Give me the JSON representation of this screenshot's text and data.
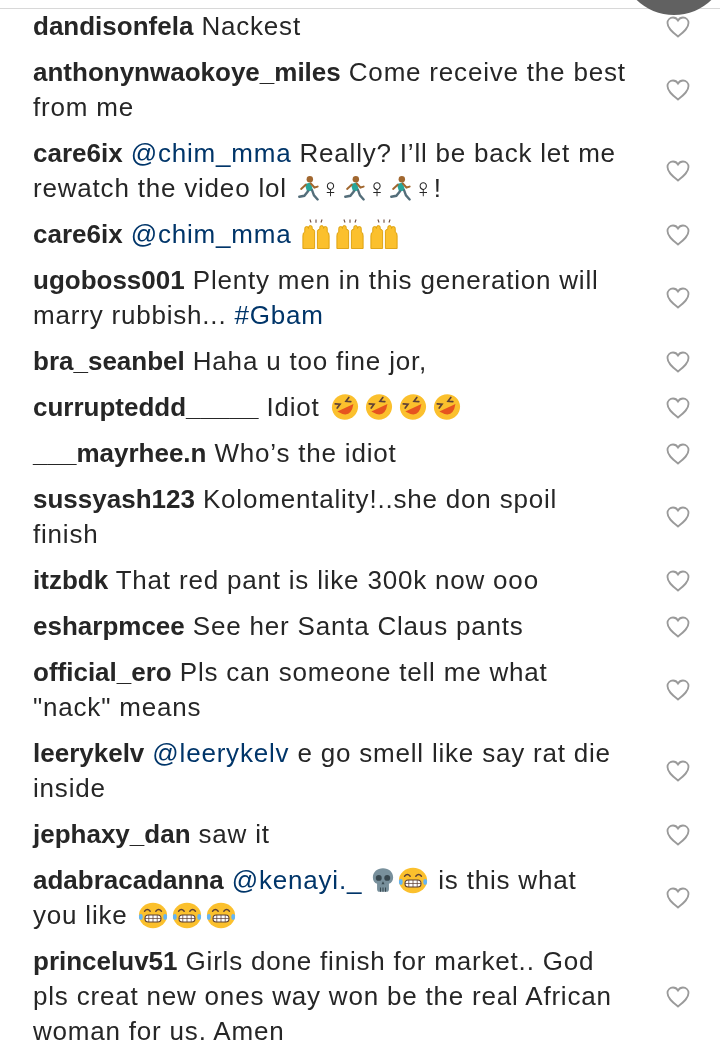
{
  "comments": [
    {
      "username": "dandisonfela",
      "liked": false,
      "parts": [
        {
          "kind": "text",
          "text": "Nackest"
        }
      ]
    },
    {
      "username": "anthonynwaokoye_miles",
      "liked": false,
      "parts": [
        {
          "kind": "text",
          "text": "Come receive the best from me"
        }
      ]
    },
    {
      "username": "care6ix",
      "liked": false,
      "parts": [
        {
          "kind": "mention",
          "text": "@chim_mma"
        },
        {
          "kind": "text",
          "text": "Really? I’ll be back let me rewatch the video lol "
        },
        {
          "kind": "runner"
        },
        {
          "kind": "text",
          "text": "♀"
        },
        {
          "kind": "runner"
        },
        {
          "kind": "text",
          "text": "♀"
        },
        {
          "kind": "runner"
        },
        {
          "kind": "text",
          "text": "♀!"
        }
      ]
    },
    {
      "username": "care6ix",
      "liked": false,
      "parts": [
        {
          "kind": "mention",
          "text": "@chim_mma"
        },
        {
          "kind": "hands"
        },
        {
          "kind": "hands"
        },
        {
          "kind": "hands"
        }
      ]
    },
    {
      "username": "ugoboss001",
      "liked": false,
      "parts": [
        {
          "kind": "text",
          "text": "Plenty men in this generation will marry rubbish..."
        },
        {
          "kind": "hashtag",
          "text": "#Gbam"
        }
      ]
    },
    {
      "username": "bra_seanbel",
      "liked": false,
      "parts": [
        {
          "kind": "text",
          "text": "Haha u too fine jor,"
        }
      ]
    },
    {
      "username": "currupteddd_____",
      "liked": false,
      "parts": [
        {
          "kind": "text",
          "text": "Idiot "
        },
        {
          "kind": "rofl"
        },
        {
          "kind": "rofl"
        },
        {
          "kind": "rofl"
        },
        {
          "kind": "rofl"
        }
      ]
    },
    {
      "username": "___mayrhee.n",
      "liked": false,
      "parts": [
        {
          "kind": "text",
          "text": "Who’s the idiot"
        }
      ]
    },
    {
      "username": "sussyash123",
      "liked": false,
      "parts": [
        {
          "kind": "text",
          "text": "Kolomentality!..she don spoil finish"
        }
      ]
    },
    {
      "username": "itzbdk",
      "liked": false,
      "parts": [
        {
          "kind": "text",
          "text": "That red pant is like 300k now ooo"
        }
      ]
    },
    {
      "username": "esharpmcee",
      "liked": false,
      "parts": [
        {
          "kind": "text",
          "text": "See her Santa Claus pants"
        }
      ]
    },
    {
      "username": "official_ero",
      "liked": false,
      "parts": [
        {
          "kind": "text",
          "text": "Pls can someone tell me what \"nack\" means"
        }
      ]
    },
    {
      "username": "leerykelv",
      "liked": false,
      "parts": [
        {
          "kind": "mention",
          "text": "@leerykelv"
        },
        {
          "kind": "text",
          "text": "e go smell like say rat die inside"
        }
      ]
    },
    {
      "username": "jephaxy_dan",
      "liked": false,
      "parts": [
        {
          "kind": "text",
          "text": "saw it"
        }
      ]
    },
    {
      "username": "adabracadanna",
      "liked": false,
      "parts": [
        {
          "kind": "mention",
          "text": "@kenayi._"
        },
        {
          "kind": "skull"
        },
        {
          "kind": "laugh"
        },
        {
          "kind": "text",
          "text": " is this what you like "
        },
        {
          "kind": "laugh"
        },
        {
          "kind": "laugh"
        },
        {
          "kind": "laugh"
        }
      ]
    },
    {
      "username": "princeluv51",
      "liked": false,
      "parts": [
        {
          "kind": "text",
          "text": "Girls done finish for market.. God pls creat new ones way won be the real African woman for us. Amen"
        }
      ]
    }
  ]
}
